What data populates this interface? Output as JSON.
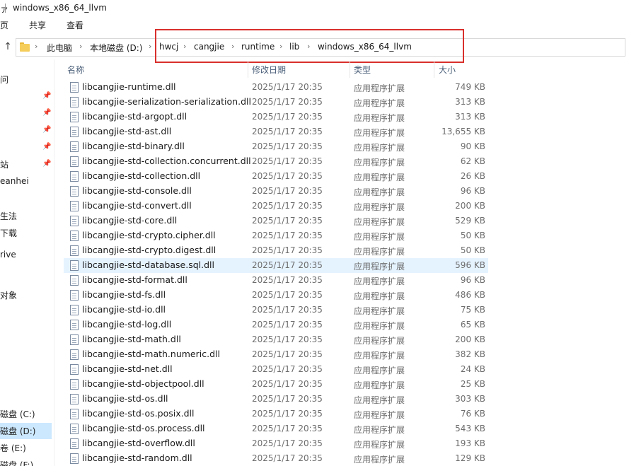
{
  "window": {
    "title_prefix": "ァ",
    "title": "windows_x86_64_llvm"
  },
  "ribbon": {
    "tabs": [
      "页",
      "共享",
      "查看"
    ]
  },
  "address": {
    "crumbs": [
      "此电脑",
      "本地磁盘 (D:)",
      "hwcj",
      "cangjie",
      "runtime",
      "lib",
      "windows_x86_64_llvm"
    ]
  },
  "nav": {
    "items": [
      "问",
      "站",
      "eanhei",
      "生法",
      "下载",
      "rive",
      "对象",
      "磁盘 (C:)",
      "磁盘 (D:)",
      "卷 (E:)",
      "磁盘 (F:)"
    ]
  },
  "list": {
    "headers": {
      "name": "名称",
      "date": "修改日期",
      "type": "类型",
      "size": "大小"
    },
    "rows": [
      {
        "name": "libcangjie-runtime.dll",
        "date": "2025/1/17 20:35",
        "type": "应用程序扩展",
        "size": "749 KB"
      },
      {
        "name": "libcangjie-serialization-serialization.dll",
        "date": "2025/1/17 20:35",
        "type": "应用程序扩展",
        "size": "313 KB"
      },
      {
        "name": "libcangjie-std-argopt.dll",
        "date": "2025/1/17 20:35",
        "type": "应用程序扩展",
        "size": "313 KB"
      },
      {
        "name": "libcangjie-std-ast.dll",
        "date": "2025/1/17 20:35",
        "type": "应用程序扩展",
        "size": "13,655 KB"
      },
      {
        "name": "libcangjie-std-binary.dll",
        "date": "2025/1/17 20:35",
        "type": "应用程序扩展",
        "size": "90 KB"
      },
      {
        "name": "libcangjie-std-collection.concurrent.dll",
        "date": "2025/1/17 20:35",
        "type": "应用程序扩展",
        "size": "62 KB"
      },
      {
        "name": "libcangjie-std-collection.dll",
        "date": "2025/1/17 20:35",
        "type": "应用程序扩展",
        "size": "26 KB"
      },
      {
        "name": "libcangjie-std-console.dll",
        "date": "2025/1/17 20:35",
        "type": "应用程序扩展",
        "size": "96 KB"
      },
      {
        "name": "libcangjie-std-convert.dll",
        "date": "2025/1/17 20:35",
        "type": "应用程序扩展",
        "size": "200 KB"
      },
      {
        "name": "libcangjie-std-core.dll",
        "date": "2025/1/17 20:35",
        "type": "应用程序扩展",
        "size": "529 KB"
      },
      {
        "name": "libcangjie-std-crypto.cipher.dll",
        "date": "2025/1/17 20:35",
        "type": "应用程序扩展",
        "size": "50 KB"
      },
      {
        "name": "libcangjie-std-crypto.digest.dll",
        "date": "2025/1/17 20:35",
        "type": "应用程序扩展",
        "size": "50 KB"
      },
      {
        "name": "libcangjie-std-database.sql.dll",
        "date": "2025/1/17 20:35",
        "type": "应用程序扩展",
        "size": "596 KB"
      },
      {
        "name": "libcangjie-std-format.dll",
        "date": "2025/1/17 20:35",
        "type": "应用程序扩展",
        "size": "96 KB"
      },
      {
        "name": "libcangjie-std-fs.dll",
        "date": "2025/1/17 20:35",
        "type": "应用程序扩展",
        "size": "486 KB"
      },
      {
        "name": "libcangjie-std-io.dll",
        "date": "2025/1/17 20:35",
        "type": "应用程序扩展",
        "size": "75 KB"
      },
      {
        "name": "libcangjie-std-log.dll",
        "date": "2025/1/17 20:35",
        "type": "应用程序扩展",
        "size": "65 KB"
      },
      {
        "name": "libcangjie-std-math.dll",
        "date": "2025/1/17 20:35",
        "type": "应用程序扩展",
        "size": "200 KB"
      },
      {
        "name": "libcangjie-std-math.numeric.dll",
        "date": "2025/1/17 20:35",
        "type": "应用程序扩展",
        "size": "382 KB"
      },
      {
        "name": "libcangjie-std-net.dll",
        "date": "2025/1/17 20:35",
        "type": "应用程序扩展",
        "size": "24 KB"
      },
      {
        "name": "libcangjie-std-objectpool.dll",
        "date": "2025/1/17 20:35",
        "type": "应用程序扩展",
        "size": "25 KB"
      },
      {
        "name": "libcangjie-std-os.dll",
        "date": "2025/1/17 20:35",
        "type": "应用程序扩展",
        "size": "303 KB"
      },
      {
        "name": "libcangjie-std-os.posix.dll",
        "date": "2025/1/17 20:35",
        "type": "应用程序扩展",
        "size": "76 KB"
      },
      {
        "name": "libcangjie-std-os.process.dll",
        "date": "2025/1/17 20:35",
        "type": "应用程序扩展",
        "size": "543 KB"
      },
      {
        "name": "libcangjie-std-overflow.dll",
        "date": "2025/1/17 20:35",
        "type": "应用程序扩展",
        "size": "193 KB"
      },
      {
        "name": "libcangjie-std-random.dll",
        "date": "2025/1/17 20:35",
        "type": "应用程序扩展",
        "size": "129 KB"
      }
    ],
    "hover_row": "libcangjie-std-database.sql.dll"
  },
  "colors": {
    "accent_highlight": "#d9302c",
    "hover": "#e5f3ff",
    "selected": "#cce8ff"
  },
  "icons": [
    "up-arrow-icon",
    "folder-icon",
    "pin-icon",
    "dll-file-icon"
  ]
}
